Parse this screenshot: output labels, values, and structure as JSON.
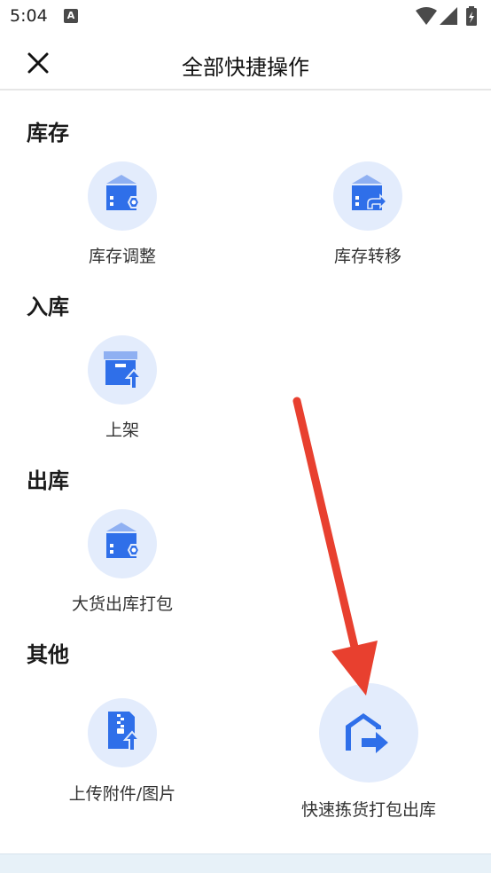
{
  "status_bar": {
    "time": "5:04",
    "notification_badge": "A",
    "icons": [
      "wifi-icon",
      "signal-icon",
      "battery-charging-icon"
    ]
  },
  "header": {
    "title": "全部快捷操作",
    "close_icon": "close-icon"
  },
  "sections": {
    "inventory": {
      "title": "库存",
      "items": [
        {
          "label": "库存调整",
          "icon": "box-adjust-icon"
        },
        {
          "label": "库存转移",
          "icon": "box-transfer-icon"
        }
      ]
    },
    "inbound": {
      "title": "入库",
      "items": [
        {
          "label": "上架",
          "icon": "box-shelve-icon"
        }
      ]
    },
    "outbound": {
      "title": "出库",
      "items": [
        {
          "label": "大货出库打包",
          "icon": "box-pack-icon"
        }
      ]
    },
    "other": {
      "title": "其他",
      "items": [
        {
          "label": "上传附件/图片",
          "icon": "upload-file-icon"
        },
        {
          "label": "快速拣货打包出库",
          "icon": "warehouse-exit-icon"
        }
      ]
    }
  },
  "colors": {
    "icon_primary": "#2f6fe9",
    "icon_light": "#8fb0f2",
    "circle_bg": "#e3ecfc",
    "annotation_arrow": "#e8402f"
  }
}
